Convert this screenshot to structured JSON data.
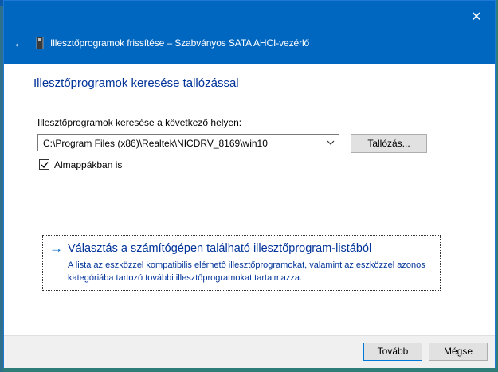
{
  "window": {
    "title": "Illesztőprogramok frissítése – Szabványos SATA AHCI-vezérlő",
    "close_icon": "close-icon",
    "back_icon": "back-arrow-icon"
  },
  "page": {
    "heading": "Illesztőprogramok keresése tallózással",
    "location_label": "Illesztőprogramok keresése a következő helyen:",
    "path_value": "C:\\Program Files (x86)\\Realtek\\NICDRV_8169\\win10",
    "browse_label": "Tallózás...",
    "include_subfolders_label": "Almappákban is",
    "include_subfolders_checked": true
  },
  "link": {
    "title": "Választás a számítógépen található illesztőprogram-listából",
    "description": "A lista az eszközzel kompatibilis elérhető illesztőprogramokat, valamint az eszközzel azonos kategóriába tartozó további illesztőprogramokat tartalmazza."
  },
  "footer": {
    "next_label": "Tovább",
    "cancel_label": "Mégse"
  },
  "colors": {
    "titlebar": "#0067c0",
    "heading": "#003399",
    "link_arrow": "#0066cc"
  }
}
